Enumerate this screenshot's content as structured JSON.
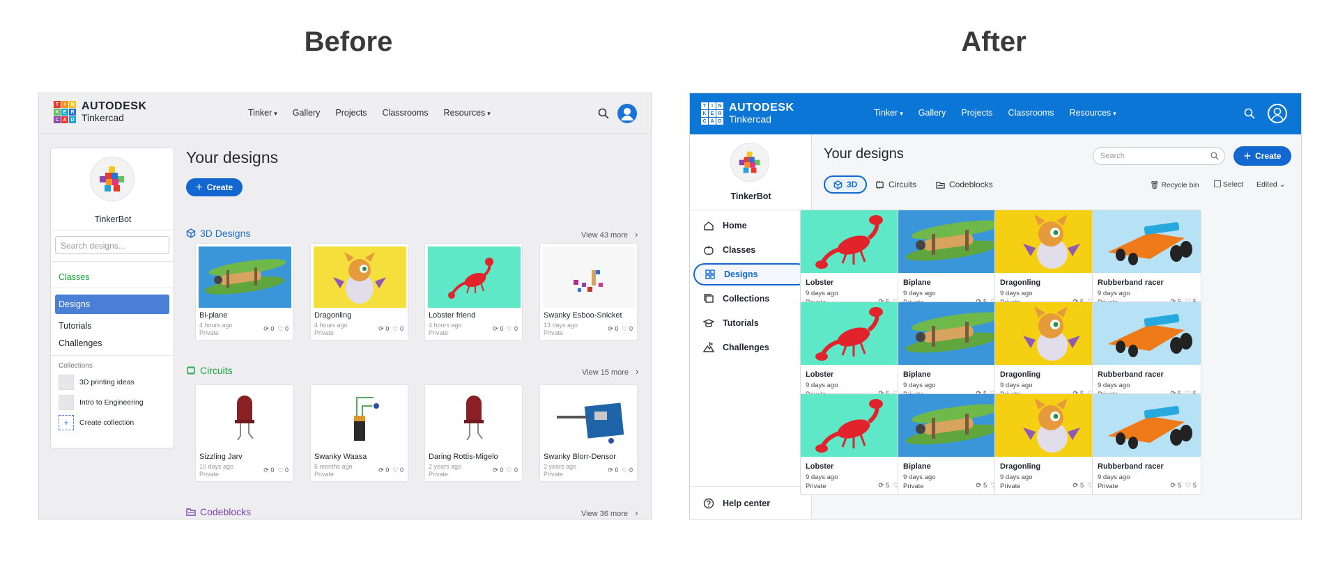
{
  "labels": {
    "before": "Before",
    "after": "After"
  },
  "colors": {
    "brand_blue": "#0c76d6",
    "accent": "#1268d0",
    "active_item": "#4a7fd6",
    "classes_green": "#19a33b"
  },
  "logo": {
    "letters": [
      "T",
      "I",
      "N",
      "K",
      "E",
      "R",
      "C",
      "A",
      "D"
    ],
    "brand": "AUTODESK",
    "product": "Tinkercad"
  },
  "nav": {
    "tinker": "Tinker",
    "gallery": "Gallery",
    "projects": "Projects",
    "classrooms": "Classrooms",
    "resources": "Resources"
  },
  "before": {
    "user": "TinkerBot",
    "search_placeholder": "Search designs...",
    "sidebar": {
      "classes": "Classes",
      "designs": "Designs",
      "tutorials": "Tutorials",
      "challenges": "Challenges"
    },
    "collections": {
      "header": "Collections",
      "items": [
        "3D printing ideas",
        "Intro to Engineering"
      ],
      "create": "Create collection"
    },
    "title": "Your designs",
    "create": "Create",
    "sections": [
      {
        "name": "3D Designs",
        "view_more": "View 43 more",
        "cards": [
          {
            "title": "Bi-plane",
            "time": "4 hours ago",
            "privacy": "Private",
            "remix": "0",
            "likes": "0"
          },
          {
            "title": "Dragonling",
            "time": "4 hours ago",
            "privacy": "Private",
            "remix": "0",
            "likes": "0"
          },
          {
            "title": "Lobster friend",
            "time": "4 hours ago",
            "privacy": "Private",
            "remix": "0",
            "likes": "0"
          },
          {
            "title": "Swanky Esboo-Snicket",
            "time": "13 days ago",
            "privacy": "Private",
            "remix": "0",
            "likes": "0"
          }
        ]
      },
      {
        "name": "Circuits",
        "view_more": "View 15 more",
        "cards": [
          {
            "title": "Sizzling Jarv",
            "time": "10 days ago",
            "privacy": "Private",
            "remix": "0",
            "likes": "0"
          },
          {
            "title": "Swanky Waasa",
            "time": "6 months ago",
            "privacy": "Private",
            "remix": "0",
            "likes": "0"
          },
          {
            "title": "Daring Rottis-Migelo",
            "time": "2 years ago",
            "privacy": "Private",
            "remix": "0",
            "likes": "0"
          },
          {
            "title": "Swanky Blorr-Densor",
            "time": "2 years ago",
            "privacy": "Private",
            "remix": "0",
            "likes": "0"
          }
        ]
      },
      {
        "name": "Codeblocks",
        "view_more": "View 36 more",
        "cards": []
      }
    ]
  },
  "after": {
    "user": "TinkerBot",
    "nav_items": [
      "Home",
      "Classes",
      "Designs",
      "Collections",
      "Tutorials",
      "Challenges"
    ],
    "help": "Help center",
    "title": "Your designs",
    "search_placeholder": "Search",
    "create": "Create",
    "tabs": [
      "3D",
      "Circuits",
      "Codeblocks"
    ],
    "tools": {
      "recycle": "Recycle bin",
      "select": "Select",
      "sort": "Edited"
    },
    "row": [
      {
        "title": "Lobster",
        "time": "9 days ago",
        "privacy": "Private",
        "remix": "5",
        "likes": "5"
      },
      {
        "title": "Biplane",
        "time": "9 days ago",
        "privacy": "Private",
        "remix": "5",
        "likes": "5"
      },
      {
        "title": "Dragonling",
        "time": "9 days ago",
        "privacy": "Private",
        "remix": "5",
        "likes": "5"
      },
      {
        "title": "Rubberband racer",
        "time": "9 days ago",
        "privacy": "Private",
        "remix": "5",
        "likes": "5"
      }
    ]
  }
}
